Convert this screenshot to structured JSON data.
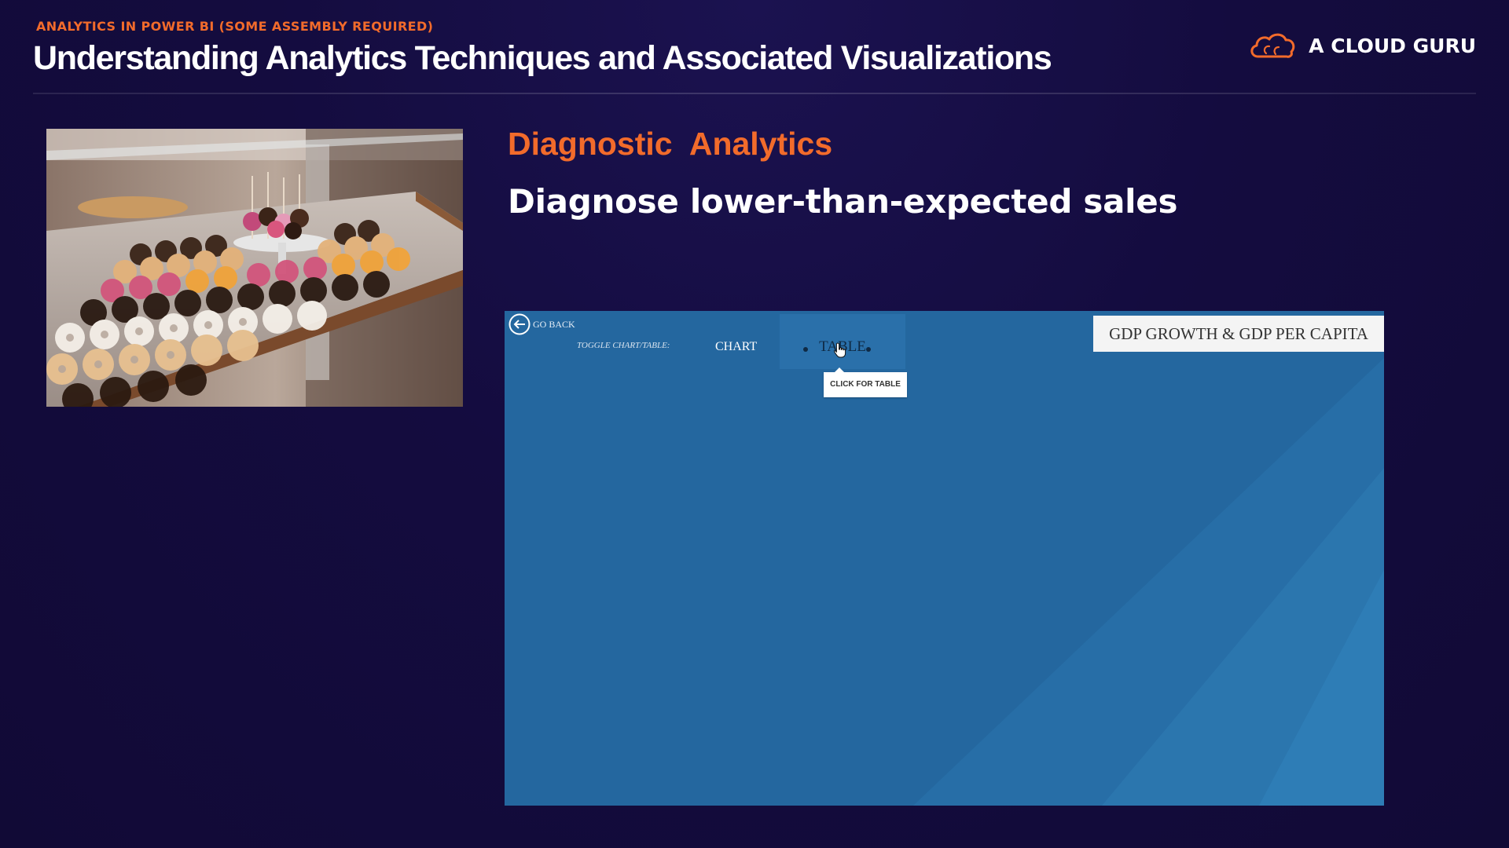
{
  "header": {
    "kicker": "ANALYTICS IN POWER BI (SOME ASSEMBLY REQUIRED)",
    "title": "Understanding Analytics Techniques and Associated Visualizations",
    "brand": {
      "name": "A CLOUD GURU",
      "icon": "cloud-logo-icon",
      "accent": "#f26b2b"
    }
  },
  "slide": {
    "section_title": "Diagnostic  Analytics",
    "subtitle": "Diagnose lower-than-expected sales",
    "photo": {
      "icon": "donut-display-photo"
    }
  },
  "report": {
    "background": "#24679f",
    "go_back": {
      "label": "GO BACK",
      "icon": "back-arrow-circle-icon"
    },
    "toggle": {
      "label": "TOGGLE CHART/TABLE:",
      "chart_label": "CHART",
      "table_label": "TABLE",
      "selected": "TABLE"
    },
    "tooltip": "CLICK FOR TABLE",
    "visual_title": "GDP GROWTH & GDP PER CAPITA"
  },
  "colors": {
    "background": "#140c3f",
    "accent": "#f26b2b",
    "text": "#ffffff"
  }
}
